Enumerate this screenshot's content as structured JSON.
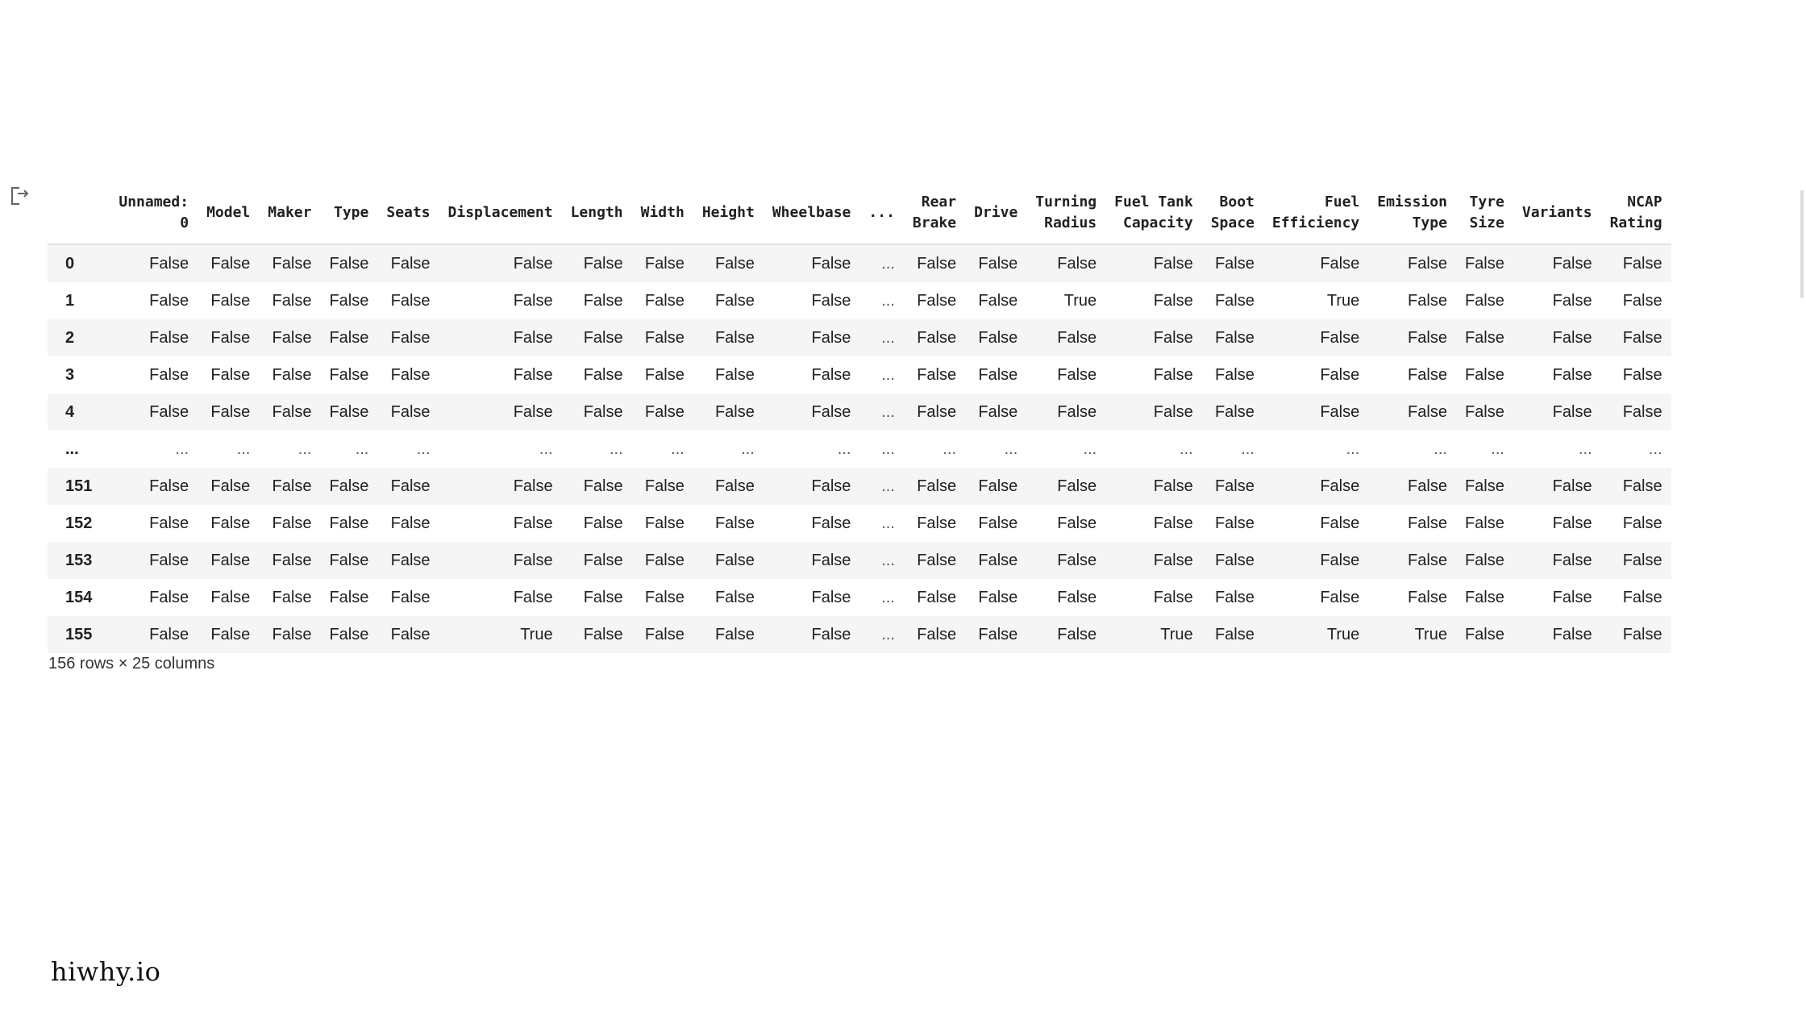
{
  "output_icon": "output-arrow-icon",
  "dataframe": {
    "columns": [
      "Unnamed: 0",
      "Model",
      "Maker",
      "Type",
      "Seats",
      "Displacement",
      "Length",
      "Width",
      "Height",
      "Wheelbase",
      "...",
      "Rear Brake",
      "Drive",
      "Turning Radius",
      "Fuel Tank Capacity",
      "Boot Space",
      "Fuel Efficiency",
      "Emission Type",
      "Tyre Size",
      "Variants",
      "NCAP Rating"
    ],
    "columns_display": [
      [
        "Unnamed:",
        "0"
      ],
      [
        "Model"
      ],
      [
        "Maker"
      ],
      [
        "Type"
      ],
      [
        "Seats"
      ],
      [
        "Displacement"
      ],
      [
        "Length"
      ],
      [
        "Width"
      ],
      [
        "Height"
      ],
      [
        "Wheelbase"
      ],
      [
        "..."
      ],
      [
        "Rear",
        "Brake"
      ],
      [
        "Drive"
      ],
      [
        "Turning",
        "Radius"
      ],
      [
        "Fuel Tank",
        "Capacity"
      ],
      [
        "Boot",
        "Space"
      ],
      [
        "Fuel",
        "Efficiency"
      ],
      [
        "Emission",
        "Type"
      ],
      [
        "Tyre",
        "Size"
      ],
      [
        "Variants"
      ],
      [
        "NCAP",
        "Rating"
      ]
    ],
    "rows": [
      {
        "index": "0",
        "values": [
          "False",
          "False",
          "False",
          "False",
          "False",
          "False",
          "False",
          "False",
          "False",
          "False",
          "...",
          "False",
          "False",
          "False",
          "False",
          "False",
          "False",
          "False",
          "False",
          "False",
          "False"
        ]
      },
      {
        "index": "1",
        "values": [
          "False",
          "False",
          "False",
          "False",
          "False",
          "False",
          "False",
          "False",
          "False",
          "False",
          "...",
          "False",
          "False",
          "True",
          "False",
          "False",
          "True",
          "False",
          "False",
          "False",
          "False"
        ]
      },
      {
        "index": "2",
        "values": [
          "False",
          "False",
          "False",
          "False",
          "False",
          "False",
          "False",
          "False",
          "False",
          "False",
          "...",
          "False",
          "False",
          "False",
          "False",
          "False",
          "False",
          "False",
          "False",
          "False",
          "False"
        ]
      },
      {
        "index": "3",
        "values": [
          "False",
          "False",
          "False",
          "False",
          "False",
          "False",
          "False",
          "False",
          "False",
          "False",
          "...",
          "False",
          "False",
          "False",
          "False",
          "False",
          "False",
          "False",
          "False",
          "False",
          "False"
        ]
      },
      {
        "index": "4",
        "values": [
          "False",
          "False",
          "False",
          "False",
          "False",
          "False",
          "False",
          "False",
          "False",
          "False",
          "...",
          "False",
          "False",
          "False",
          "False",
          "False",
          "False",
          "False",
          "False",
          "False",
          "False"
        ]
      },
      {
        "index": "...",
        "values": [
          "...",
          "...",
          "...",
          "...",
          "...",
          "...",
          "...",
          "...",
          "...",
          "...",
          "...",
          "...",
          "...",
          "...",
          "...",
          "...",
          "...",
          "...",
          "...",
          "...",
          "..."
        ]
      },
      {
        "index": "151",
        "values": [
          "False",
          "False",
          "False",
          "False",
          "False",
          "False",
          "False",
          "False",
          "False",
          "False",
          "...",
          "False",
          "False",
          "False",
          "False",
          "False",
          "False",
          "False",
          "False",
          "False",
          "False"
        ]
      },
      {
        "index": "152",
        "values": [
          "False",
          "False",
          "False",
          "False",
          "False",
          "False",
          "False",
          "False",
          "False",
          "False",
          "...",
          "False",
          "False",
          "False",
          "False",
          "False",
          "False",
          "False",
          "False",
          "False",
          "False"
        ]
      },
      {
        "index": "153",
        "values": [
          "False",
          "False",
          "False",
          "False",
          "False",
          "False",
          "False",
          "False",
          "False",
          "False",
          "...",
          "False",
          "False",
          "False",
          "False",
          "False",
          "False",
          "False",
          "False",
          "False",
          "False"
        ]
      },
      {
        "index": "154",
        "values": [
          "False",
          "False",
          "False",
          "False",
          "False",
          "False",
          "False",
          "False",
          "False",
          "False",
          "...",
          "False",
          "False",
          "False",
          "False",
          "False",
          "False",
          "False",
          "False",
          "False",
          "False"
        ]
      },
      {
        "index": "155",
        "values": [
          "False",
          "False",
          "False",
          "False",
          "False",
          "True",
          "False",
          "False",
          "False",
          "False",
          "...",
          "False",
          "False",
          "False",
          "True",
          "False",
          "True",
          "True",
          "False",
          "False",
          "False"
        ]
      }
    ],
    "shape_text": "156 rows × 25 columns"
  },
  "watermark": "hiwhy.io",
  "colors": {
    "row_stripe": "#f5f5f5",
    "header_border": "#e0e0e0",
    "text": "#212121"
  }
}
